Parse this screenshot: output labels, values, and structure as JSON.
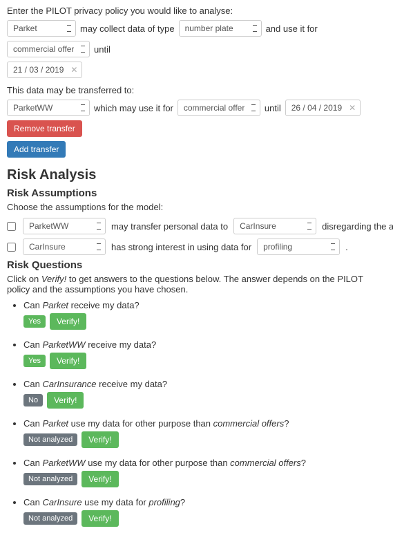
{
  "policy": {
    "prompt": "Enter the PILOT privacy policy you would like to analyse:",
    "subject": "Parket",
    "may_collect_label": "may collect data of type",
    "data_type": "number plate",
    "use_for_label": "and use it for",
    "purpose": "commercial offers",
    "until_label": "until",
    "until_date": "21 / 03 / 2019"
  },
  "transfer": {
    "prompt": "This data may be transferred to:",
    "recipient": "ParketWW",
    "which_may_label": "which may use it for",
    "purpose": "commercial offers",
    "until_label": "until",
    "until_date": "26 / 04 / 2019",
    "remove_label": "Remove transfer",
    "add_label": "Add transfer"
  },
  "risk": {
    "heading": "Risk Analysis",
    "assumptions_heading": "Risk Assumptions",
    "assumptions_prompt": "Choose the assumptions for the model:",
    "assumption1": {
      "actor": "ParketWW",
      "mid": "may transfer personal data to",
      "target": "CarInsure",
      "tail": "disregarding the associated DS policies."
    },
    "assumption2": {
      "actor": "CarInsure",
      "mid": "has strong interest in using data for",
      "purpose": "profiling",
      "tail": "."
    },
    "questions_heading": "Risk Questions",
    "questions_prompt_a": "Click on ",
    "questions_prompt_verify": "Verify!",
    "questions_prompt_b": " to get answers to the questions below. The answer depends on the PILOT policy and the assumptions you have chosen.",
    "verify_label": "Verify!",
    "badges": {
      "yes": "Yes",
      "no": "No",
      "na": "Not analyzed"
    },
    "questions": [
      {
        "html": "Can <em>Parket</em> receive my data?",
        "status": "yes"
      },
      {
        "html": "Can <em>ParketWW</em> receive my data?",
        "status": "yes"
      },
      {
        "html": "Can <em>CarInsurance</em> receive my data?",
        "status": "no"
      },
      {
        "html": "Can <em>Parket</em> use my data for other purpose than <em>commercial offers</em>?",
        "status": "na"
      },
      {
        "html": "Can <em>ParketWW</em> use my data for other purpose than <em>commercial offers</em>?",
        "status": "na"
      },
      {
        "html": "Can <em>CarInsure</em> use my data for <em>profiling</em>?",
        "status": "na"
      }
    ]
  }
}
